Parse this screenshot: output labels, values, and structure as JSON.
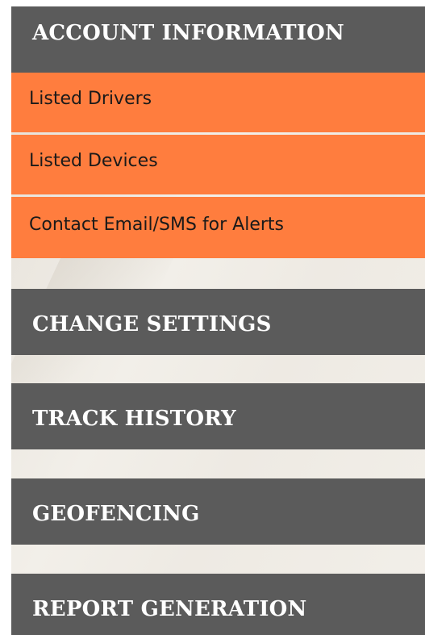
{
  "sections": [
    {
      "label": "ACCOUNT INFORMATION"
    },
    {
      "label": "CHANGE SETTINGS"
    },
    {
      "label": "TRACK HISTORY"
    },
    {
      "label": "GEOFENCING"
    },
    {
      "label": "REPORT GENERATION"
    }
  ],
  "account_submenu": [
    {
      "label": "Listed Drivers"
    },
    {
      "label": "Listed Devices"
    },
    {
      "label": "Contact Email/SMS for Alerts"
    }
  ],
  "colors": {
    "heading_bg": "#5b5b5b",
    "heading_text": "#ffffff",
    "submenu_bg": "#ff7d3e",
    "submenu_text": "#1a1a1a",
    "panel_bg": "#efebe4"
  }
}
